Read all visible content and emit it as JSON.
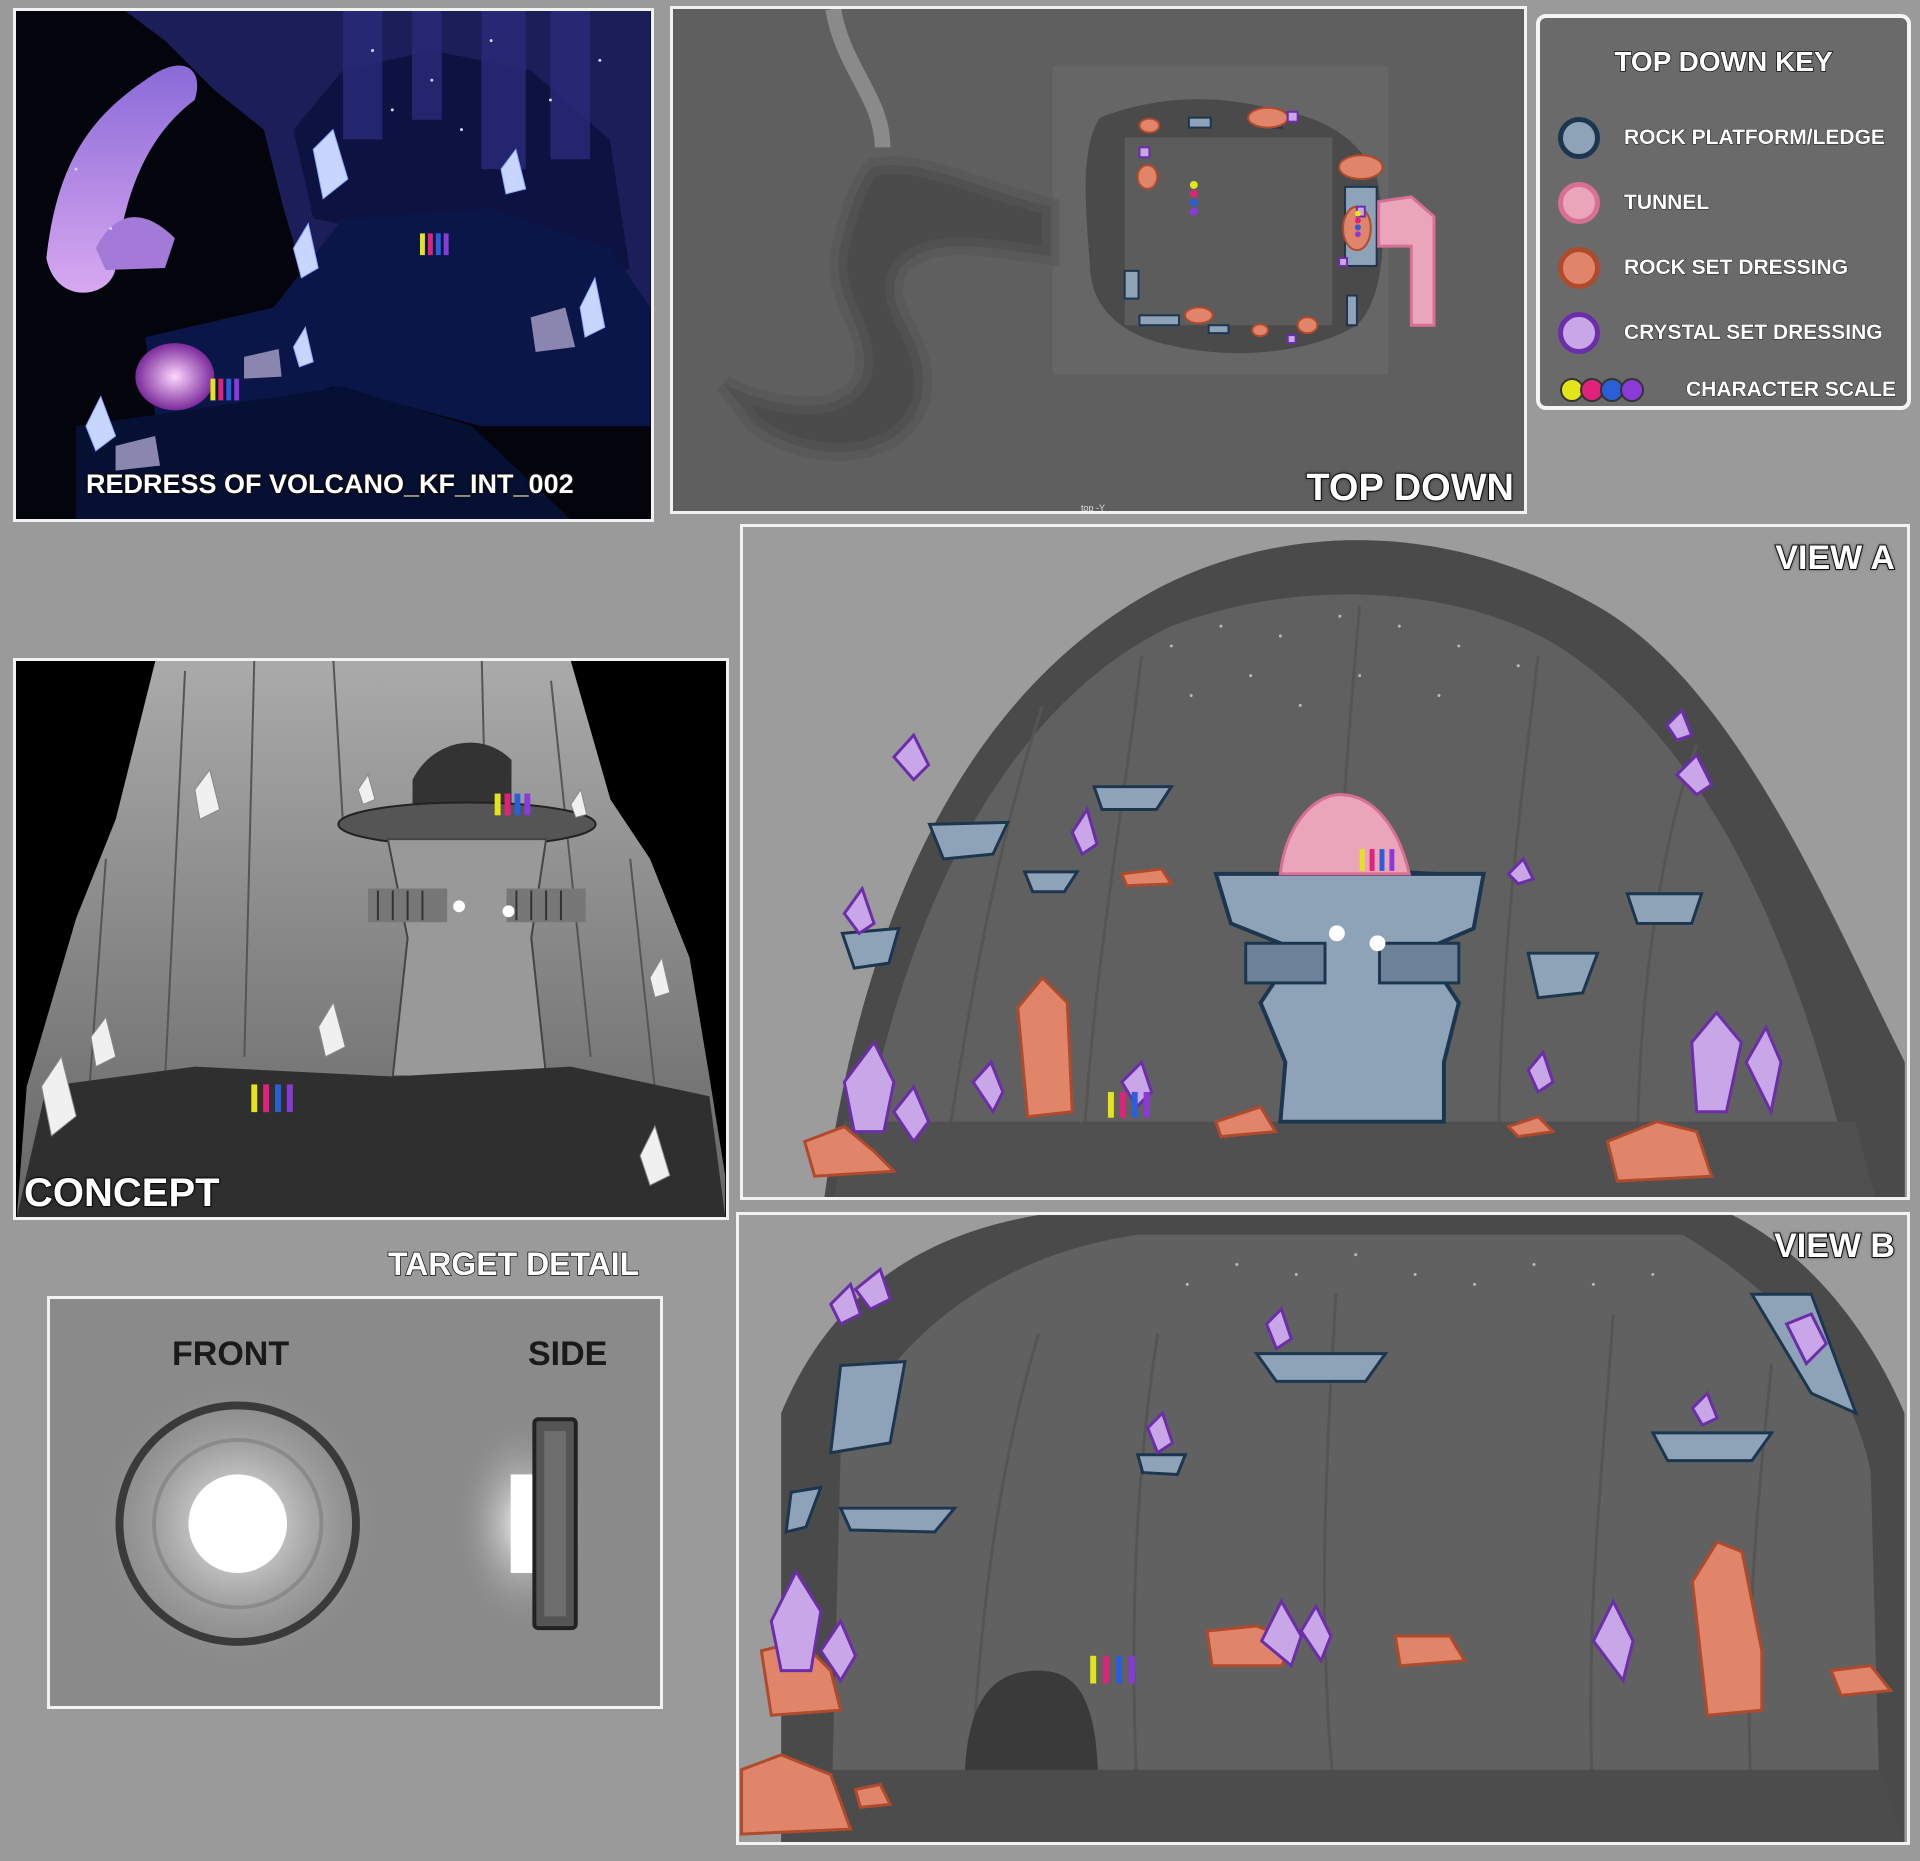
{
  "panels": {
    "redress": {
      "caption": "REDRESS OF VOLCANO_KF_INT_002"
    },
    "top_down": {
      "caption": "TOP DOWN",
      "small_label": "top -Y"
    },
    "concept": {
      "caption": "CONCEPT"
    },
    "view_a": {
      "caption": "VIEW A"
    },
    "view_b": {
      "caption": "VIEW B"
    },
    "target_detail": {
      "title": "TARGET DETAIL",
      "front_label": "FRONT",
      "side_label": "SIDE"
    }
  },
  "key": {
    "title": "TOP DOWN KEY",
    "items": [
      {
        "label": "ROCK PLATFORM/LEDGE",
        "fill": "#8ea3b8",
        "stroke": "#1d3650"
      },
      {
        "label": "TUNNEL",
        "fill": "#eaa5bb",
        "stroke": "#d86f94"
      },
      {
        "label": "ROCK SET DRESSING",
        "fill": "#e0856a",
        "stroke": "#b04a2c"
      },
      {
        "label": "CRYSTAL SET DRESSING",
        "fill": "#c8a6e8",
        "stroke": "#6b2ea8"
      },
      {
        "label": "CHARACTER SCALE",
        "dot_colors": [
          "#e4e41a",
          "#e0227a",
          "#2a5fd8",
          "#8a3ad8"
        ]
      }
    ]
  }
}
